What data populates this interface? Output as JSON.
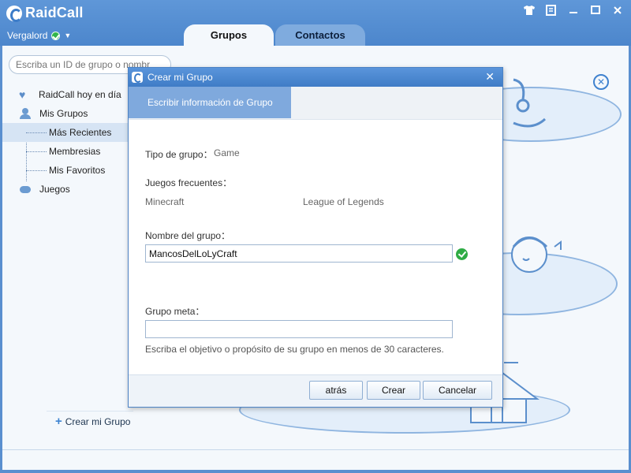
{
  "app": {
    "name": "RaidCall",
    "username": "Vergalord",
    "status_icon": "online-check-icon"
  },
  "window_controls": [
    "shirt-icon",
    "notepad-icon",
    "minimize-icon",
    "maximize-icon",
    "close-icon"
  ],
  "tabs": [
    {
      "label": "Grupos",
      "active": true
    },
    {
      "label": "Contactos",
      "active": false
    }
  ],
  "search": {
    "placeholder": "Escriba un ID de grupo o nombre"
  },
  "sidebar": {
    "items": [
      {
        "label": "RaidCall hoy en día",
        "icon": "heart-icon"
      },
      {
        "label": "Mis Grupos",
        "icon": "person-icon"
      },
      {
        "label": "Más Recientes",
        "selected": true
      },
      {
        "label": "Membresias"
      },
      {
        "label": "Mis Favoritos"
      },
      {
        "label": "Juegos",
        "icon": "gamepad-icon"
      }
    ],
    "create_group": "Crear mi Grupo"
  },
  "dialog": {
    "title": "Crear mi Grupo",
    "tab": "Escribir información de Grupo",
    "group_type_label": "Tipo de grupo：",
    "group_type_value": "Game",
    "frequent_games_label": "Juegos frecuentes：",
    "games": [
      "Minecraft",
      "League of Legends"
    ],
    "group_name_label": "Nombre del grupo：",
    "group_name_value": "MancosDelLoLyCraft",
    "goal_label": "Grupo meta：",
    "goal_value": "",
    "goal_hint": "Escriba el objetivo o propósito de su grupo en menos de 30 caracteres.",
    "buttons": {
      "back": "atrás",
      "create": "Crear",
      "cancel": "Cancelar"
    }
  },
  "colors": {
    "accent": "#4c86cc",
    "success": "#2eab44",
    "background": "#f4f8fc"
  }
}
